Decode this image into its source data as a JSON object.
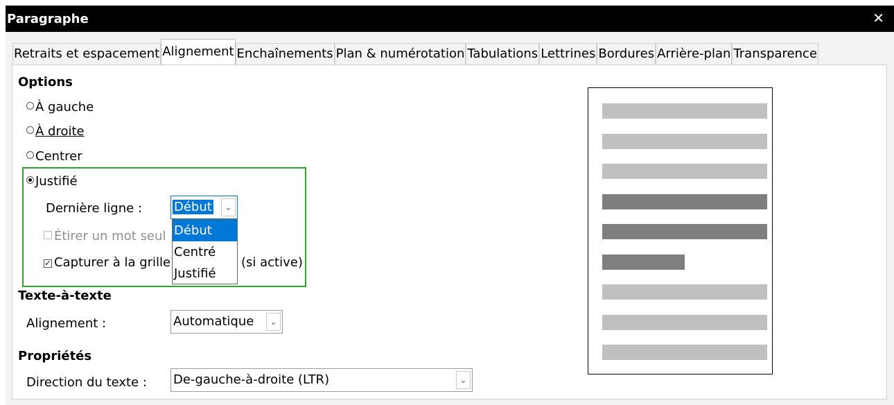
{
  "window": {
    "title": "Paragraphe",
    "close_icon": "close-icon"
  },
  "tabs": [
    {
      "label": "Retraits et espacement",
      "active": false
    },
    {
      "label": "Alignement",
      "active": true
    },
    {
      "label": "Enchaînements",
      "active": false
    },
    {
      "label": "Plan & numérotation",
      "active": false
    },
    {
      "label": "Tabulations",
      "active": false
    },
    {
      "label": "Lettrines",
      "active": false
    },
    {
      "label": "Bordures",
      "active": false
    },
    {
      "label": "Arrière-plan",
      "active": false
    },
    {
      "label": "Transparence",
      "active": false
    }
  ],
  "options": {
    "heading": "Options",
    "radios": [
      {
        "label": "À gauche",
        "checked": false
      },
      {
        "label": "À droite",
        "checked": false
      },
      {
        "label": "Centrer",
        "checked": false
      },
      {
        "label": "Justifié",
        "checked": true
      }
    ],
    "last_line": {
      "label": "Dernière ligne :",
      "value": "Début",
      "dropdown_open": true,
      "options": [
        "Début",
        "Centré",
        "Justifié"
      ],
      "selected_index": 0
    },
    "stretch_word": {
      "label": "Étirer un mot seul",
      "checked": false,
      "enabled": false
    },
    "snap_grid": {
      "label": "Capturer à la grille",
      "suffix": "(si active)",
      "checked": true
    }
  },
  "text_to_text": {
    "heading": "Texte-à-texte",
    "alignment_label": "Alignement :",
    "alignment_value": "Automatique"
  },
  "properties": {
    "heading": "Propriétés",
    "direction_label": "Direction du texte :",
    "direction_value": "De-gauche-à-droite (LTR)"
  },
  "colors": {
    "highlight_border": "#2aa52a",
    "selection": "#0078d7",
    "preview_light": "#c0c0c0",
    "preview_dark": "#7f7f7f"
  },
  "preview_lines": [
    {
      "kind": "light",
      "width_fraction": 1.0
    },
    {
      "kind": "light",
      "width_fraction": 1.0
    },
    {
      "kind": "light",
      "width_fraction": 1.0
    },
    {
      "kind": "dark",
      "width_fraction": 1.0
    },
    {
      "kind": "dark",
      "width_fraction": 1.0
    },
    {
      "kind": "dark",
      "width_fraction": 0.5
    },
    {
      "kind": "light",
      "width_fraction": 1.0
    },
    {
      "kind": "light",
      "width_fraction": 1.0
    },
    {
      "kind": "light",
      "width_fraction": 1.0
    }
  ]
}
